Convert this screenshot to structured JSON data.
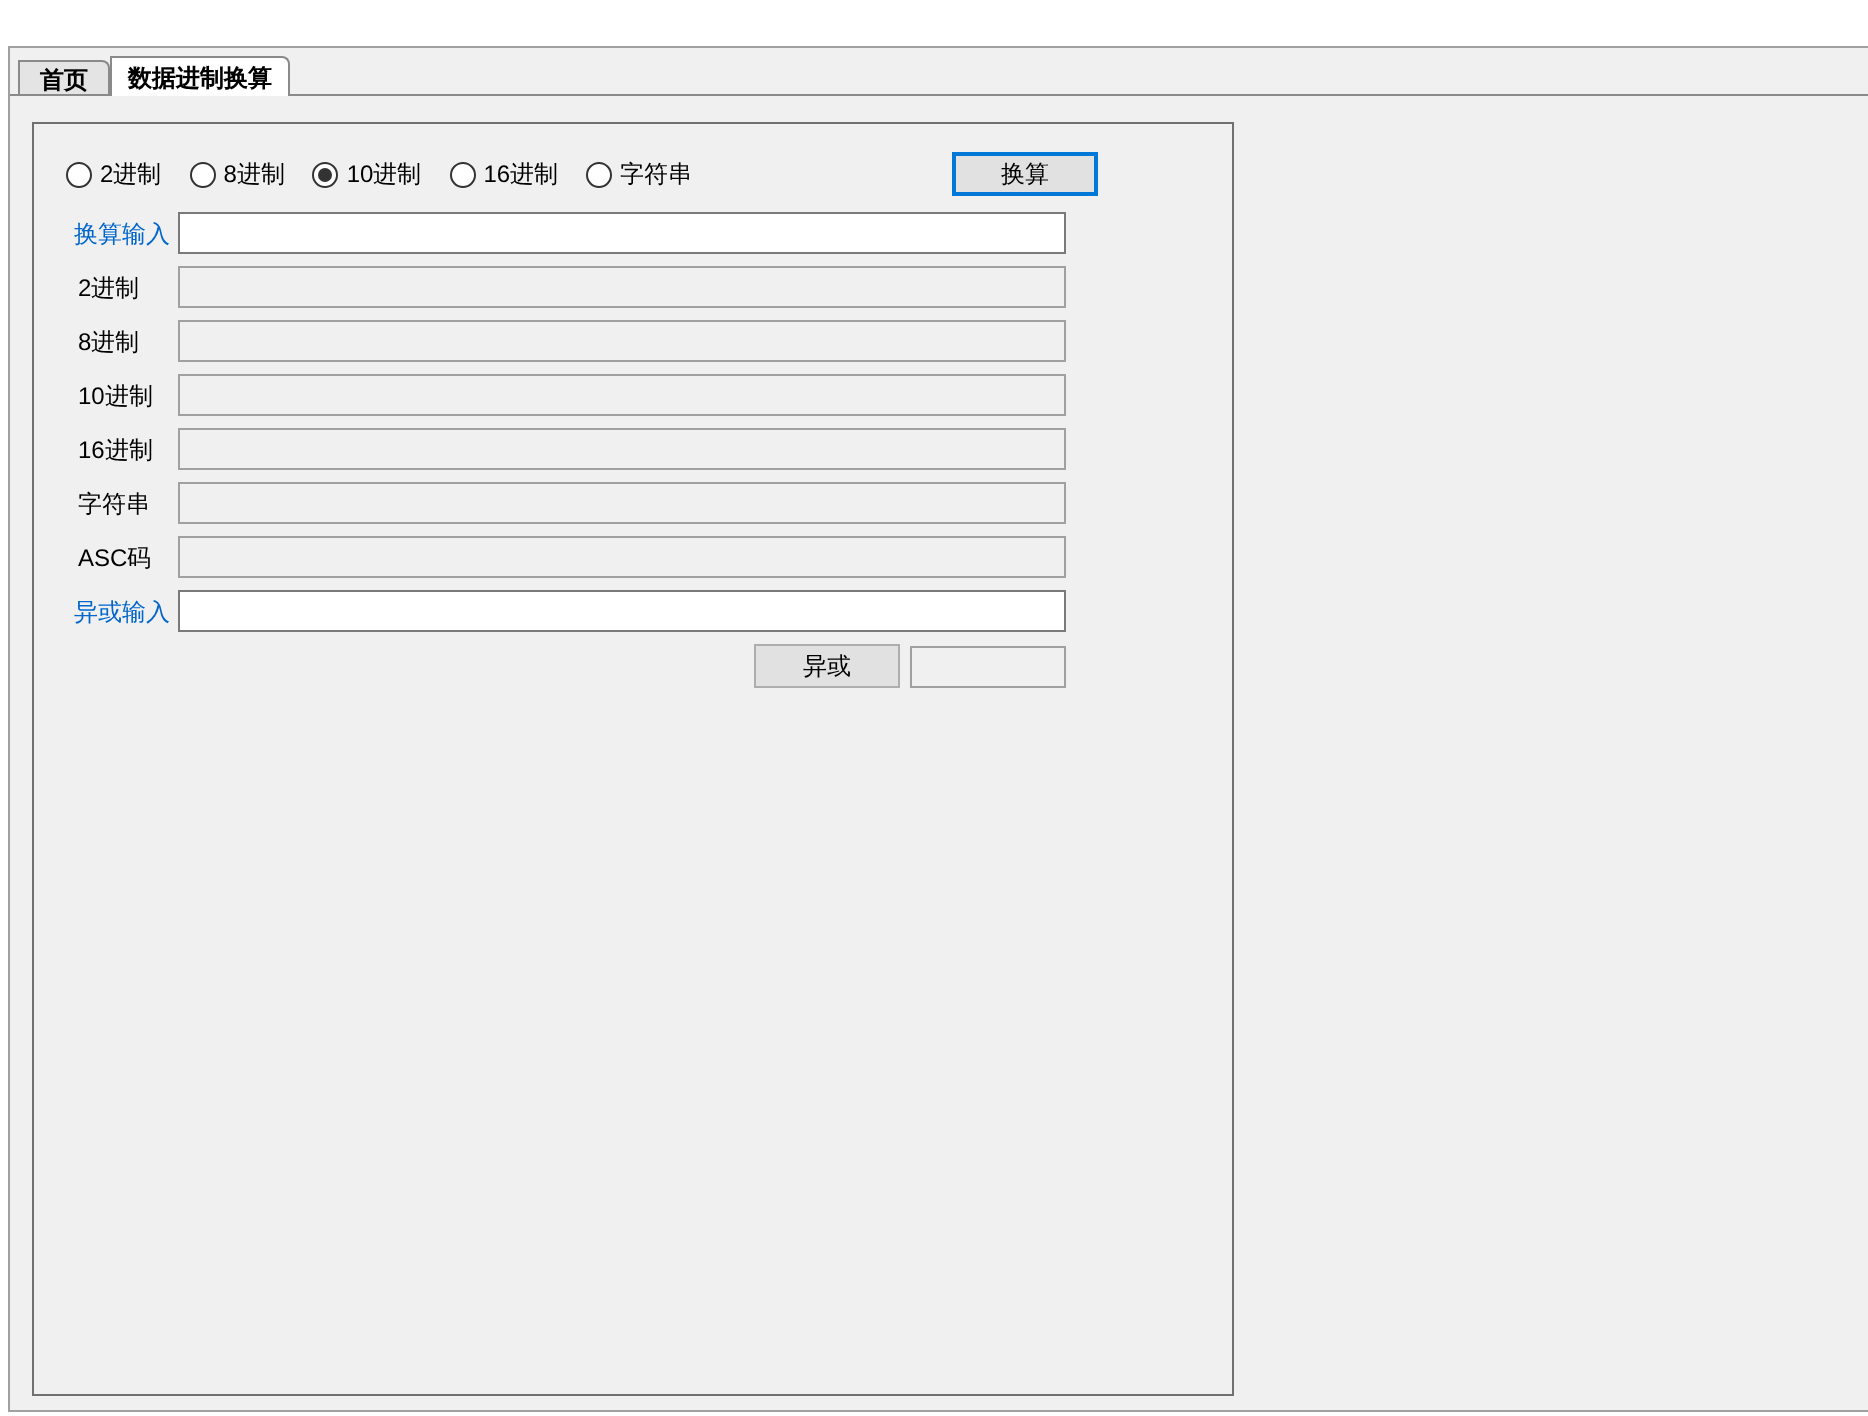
{
  "tabs": [
    {
      "label": "首页",
      "selected": false
    },
    {
      "label": "数据进制换算",
      "selected": true
    }
  ],
  "radios": [
    {
      "label": "2进制",
      "selected": false
    },
    {
      "label": "8进制",
      "selected": false
    },
    {
      "label": "10进制",
      "selected": true
    },
    {
      "label": "16进制",
      "selected": false
    },
    {
      "label": "字符串",
      "selected": false
    }
  ],
  "convert_button": "换算",
  "fields": [
    {
      "label": "换算输入",
      "kind": "editable"
    },
    {
      "label": "2进制",
      "kind": "readonly"
    },
    {
      "label": "8进制",
      "kind": "readonly"
    },
    {
      "label": "10进制",
      "kind": "readonly"
    },
    {
      "label": "16进制",
      "kind": "readonly"
    },
    {
      "label": "字符串",
      "kind": "readonly"
    },
    {
      "label": "ASC码",
      "kind": "readonly"
    },
    {
      "label": "异或输入",
      "kind": "editable"
    }
  ],
  "xor_button": "异或"
}
